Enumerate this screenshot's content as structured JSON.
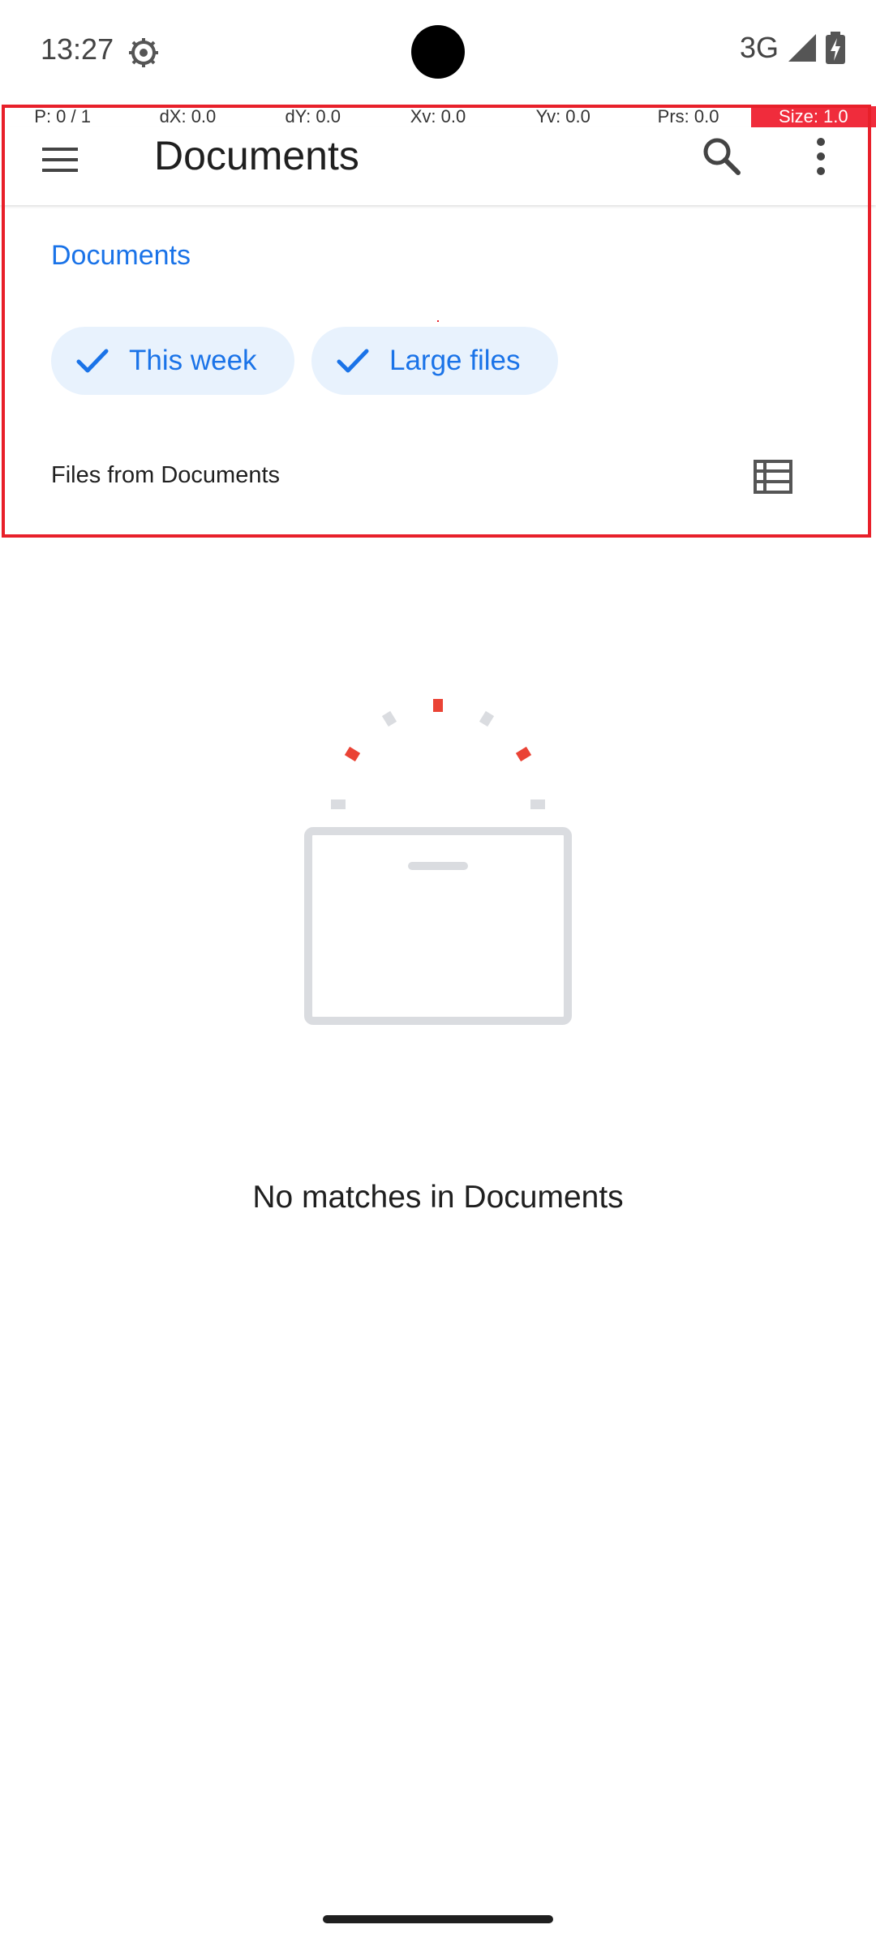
{
  "status_bar": {
    "time": "13:27",
    "network": "3G"
  },
  "pointer_overlay": {
    "items": [
      "P: 0 / 1",
      "dX: 0.0",
      "dY: 0.0",
      "Xv: 0.0",
      "Yv: 0.0",
      "Prs: 0.0",
      "Size: 1.0"
    ],
    "highlight_color": "#f02c3c"
  },
  "app_bar": {
    "title": "Documents",
    "icons": [
      "menu-icon",
      "search-icon",
      "more-vert-icon"
    ]
  },
  "content": {
    "section_heading": "Documents",
    "chips": [
      {
        "label": "This week",
        "selected": true
      },
      {
        "label": "Large files",
        "selected": true
      }
    ],
    "files_label": "Files from Documents",
    "empty_message": "No matches in Documents"
  },
  "colors": {
    "accent": "#1a73e8",
    "chip_bg": "#e8f2fd",
    "highlight": "#e8202a"
  }
}
